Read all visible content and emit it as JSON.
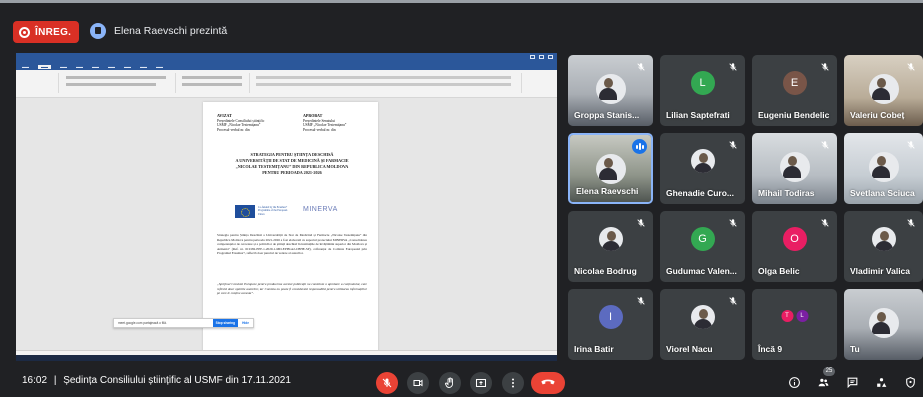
{
  "header": {
    "rec_label": "ÎNREG.",
    "presenter_text": "Elena Raevschi prezintă"
  },
  "shared_screen": {
    "document": {
      "approve_left": [
        "AVIZAT",
        "Președintele Consiliului științific",
        "USMF „Nicolae Testemițanu”",
        "Procesul-verbal nr.      din"
      ],
      "approve_right": [
        "APROBAT",
        "Președintele Senatului",
        "USMF „Nicolae Testemițanu”",
        "Procesul-verbal nr.      din"
      ],
      "title_lines": [
        "STRATEGIA PENTRU ȘTIINȚA DESCHISĂ",
        "A UNIVERSITĂȚII DE STAT DE MEDICINĂ ȘI FARMACIE",
        "„NICOLAE TESTEMIȚANU” DIN REPUBLICA MOLDOVA",
        "PENTRU PERIOADA 2021-2026"
      ],
      "eu_logo_text": "Co-funded by the Erasmus+ Programme of the European Union",
      "minerva_logo_text": "MINERVA",
      "para1": "Strategia pentru Știința Deschisă a Universității de Stat de Medicină și Farmacie „Nicolae Testemițanu” din Republica Moldova pentru perioada 2021-2026 a fost elaborată cu suportul proiectului MINERVA „Consolidarea competențelor de cercetare și a politicilor de știință deschisă în instituțiile de învățământ superior din Moldova și Armenia” (Ref. nr. 619182-EPP-1-2020-1-MD-EPPKA2-CBHE-SP), cofinanțat de Comisia Europeană prin Programul Erasmus+, reflectă doar punctul de vedere al autorilor.",
      "para2": "„Sprijinul Comisiei Europene pentru producerea acestei publicații nu constituie o aprobare a conținutului, care reflectă doar opiniile autorilor, iar Comisia nu poate fi considerată responsabilă pentru utilizarea informațiilor pe care le conține aceasta”."
    },
    "share_bar": {
      "message": "meet.google.com partajează o filă.",
      "stop_label": "Stop sharing",
      "hide_label": "Hide"
    }
  },
  "participants": [
    {
      "name": "Groppa Stanis...",
      "type": "video",
      "muted": true
    },
    {
      "name": "Lilian Saptefrati",
      "type": "letter",
      "letter": "L",
      "color": "#33a852",
      "muted": true
    },
    {
      "name": "Eugeniu Bendelic",
      "type": "letter",
      "letter": "E",
      "color": "#795548",
      "muted": true
    },
    {
      "name": "Valeriu Cobeț",
      "type": "video",
      "muted": true
    },
    {
      "name": "Elena Raevschi",
      "type": "video",
      "speaking": true
    },
    {
      "name": "Ghenadie Curo...",
      "type": "photo",
      "muted": true
    },
    {
      "name": "Mihail Todiras",
      "type": "video",
      "muted": true
    },
    {
      "name": "Svetlana Sciuca",
      "type": "video",
      "muted": true
    },
    {
      "name": "Nicolae Bodrug",
      "type": "photo",
      "muted": true
    },
    {
      "name": "Gudumac Valen...",
      "type": "letter",
      "letter": "G",
      "color": "#33a852",
      "muted": true
    },
    {
      "name": "Olga Belic",
      "type": "letter",
      "letter": "O",
      "color": "#e91e63",
      "muted": true
    },
    {
      "name": "Vladimir Valica",
      "type": "photo",
      "muted": true
    },
    {
      "name": "Irina Batir",
      "type": "letter",
      "letter": "I",
      "color": "#5c6bc0",
      "muted": true
    },
    {
      "name": "Viorel Nacu",
      "type": "photo",
      "muted": true
    },
    {
      "name": "Încă 9",
      "type": "more",
      "letters": [
        "T",
        "L"
      ],
      "colors": [
        "#e91e63",
        "#7b1fa2"
      ]
    },
    {
      "name": "Tu",
      "type": "video"
    }
  ],
  "bottom": {
    "time": "16:02",
    "separator": "|",
    "meeting_title": "Ședința Consiliului științific al USMF din 17.11.2021",
    "participant_count": "25"
  },
  "colors": {
    "bg": "#202124",
    "tile": "#3c4043",
    "danger": "#ea4335",
    "accent": "#8ab4f8"
  }
}
